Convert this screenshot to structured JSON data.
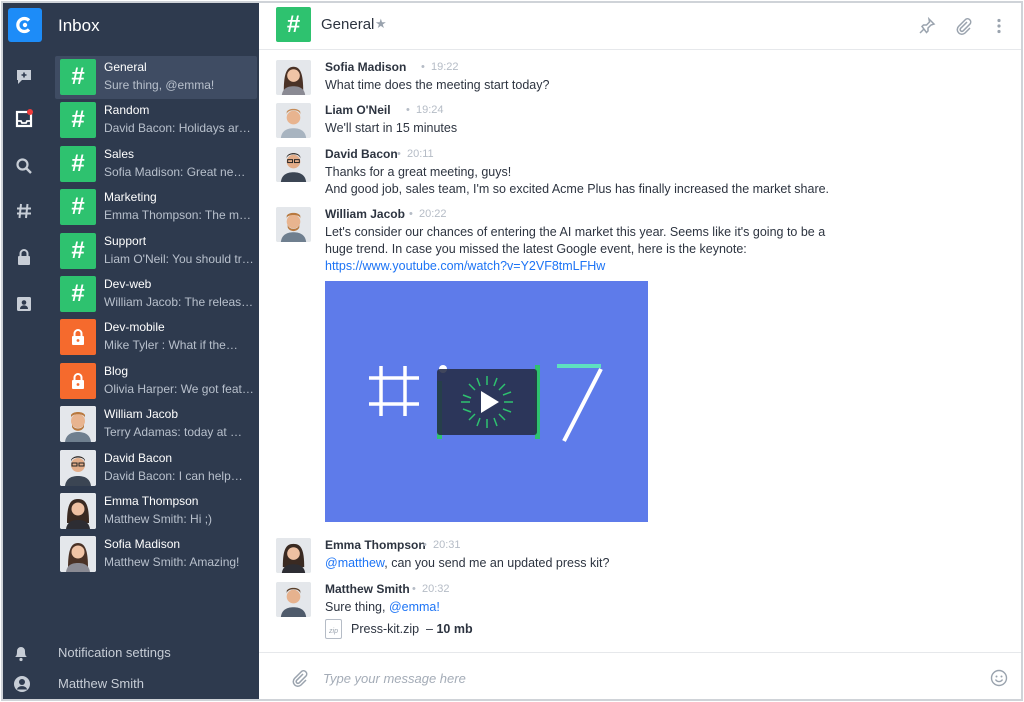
{
  "sidebar": {
    "title": "Inbox",
    "channels": [
      {
        "name": "General",
        "preview": "Sure thing, @emma!",
        "kind": "channel"
      },
      {
        "name": "Random",
        "preview": "David Bacon: Holidays are…",
        "kind": "channel"
      },
      {
        "name": "Sales",
        "preview": "Sofia Madison: Great news…",
        "kind": "channel"
      },
      {
        "name": "Marketing",
        "preview": "Emma Thompson: The main…",
        "kind": "channel"
      },
      {
        "name": "Support",
        "preview": "Liam O'Neil: You should try…",
        "kind": "channel"
      },
      {
        "name": "Dev-web",
        "preview": "William Jacob: The release…",
        "kind": "channel"
      },
      {
        "name": "Dev-mobile",
        "preview": "Mike Tyler : What if the…",
        "kind": "private"
      },
      {
        "name": "Blog",
        "preview": "Olivia Harper: We got featur…",
        "kind": "private"
      },
      {
        "name": "William Jacob",
        "preview": "Terry Adamas: today at …",
        "kind": "direct"
      },
      {
        "name": "David Bacon",
        "preview": "David Bacon: I can help…",
        "kind": "direct"
      },
      {
        "name": "Emma Thompson",
        "preview": "Matthew Smith: Hi ;)",
        "kind": "direct"
      },
      {
        "name": "Sofia Madison",
        "preview": "Matthew Smith: Amazing!",
        "kind": "direct"
      }
    ],
    "notification_settings": "Notification settings",
    "user_name": "Matthew Smith"
  },
  "header": {
    "channel_title": "General",
    "icons": [
      "pin-icon",
      "paperclip-icon",
      "more-vertical-icon"
    ]
  },
  "messages": [
    {
      "author": "Sofia Madison",
      "time": "19:22",
      "lines": [
        "What time does the meeting start today?"
      ]
    },
    {
      "author": "Liam O'Neil",
      "time": "19:24",
      "lines": [
        "We'll start in 15 minutes"
      ]
    },
    {
      "author": "David Bacon",
      "time": "20:11",
      "lines": [
        "Thanks for a great meeting, guys!",
        "And good job, sales team, I'm so excited Acme Plus has finally increased the market share."
      ]
    },
    {
      "author": "William Jacob",
      "time": "20:22",
      "lines": [
        "Let's consider our chances of entering the AI market this year. Seems like it's going to be a",
        "huge trend. In case you missed the latest Google event, here is the keynote:"
      ],
      "link": "https://www.youtube.com/watch?v=Y2VF8tmLFHw"
    },
    {
      "author": "Emma Thompson",
      "time": "20:31",
      "mention": "@matthew",
      "text": ", can you send me an updated press kit?"
    },
    {
      "author": "Matthew Smith",
      "time": "20:32",
      "text": "Sure thing, ",
      "mention": "@emma!",
      "attachment": {
        "name": "Press-kit.zip",
        "size": "10 mb",
        "badge": "zip"
      }
    }
  ],
  "composer": {
    "placeholder": "Type your message here"
  },
  "colors": {
    "sidebar": "#2e3a4e",
    "channel_green": "#2ec26f",
    "private_orange": "#f56a2d",
    "link": "#1d74f5",
    "video": "#5e7bea"
  }
}
